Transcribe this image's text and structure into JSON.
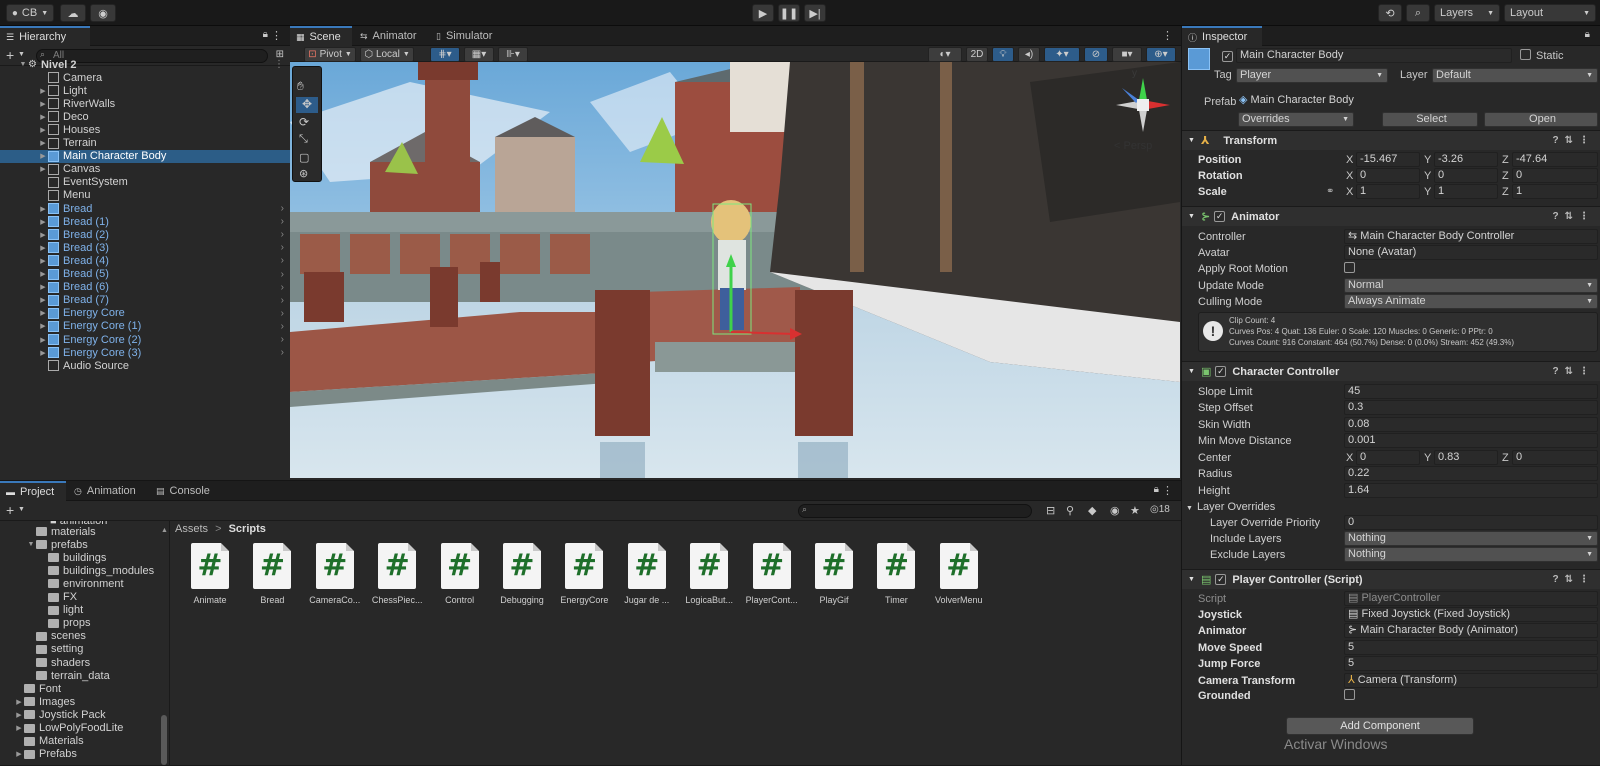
{
  "toolbar": {
    "account": "CB",
    "layers": "Layers",
    "layout": "Layout"
  },
  "hierarchy": {
    "tab": "Hierarchy",
    "search_placeholder": "All",
    "scene_name": "Nivel 2",
    "items": [
      {
        "label": "Camera",
        "blue": false,
        "expand": false
      },
      {
        "label": "Light",
        "blue": false,
        "expand": true
      },
      {
        "label": "RiverWalls",
        "blue": false,
        "expand": true
      },
      {
        "label": "Deco",
        "blue": false,
        "expand": true
      },
      {
        "label": "Houses",
        "blue": false,
        "expand": true
      },
      {
        "label": "Terrain",
        "blue": false,
        "expand": true
      },
      {
        "label": "Main Character Body",
        "blue": false,
        "expand": true,
        "selected": true
      },
      {
        "label": "Canvas",
        "blue": false,
        "expand": true
      },
      {
        "label": "EventSystem",
        "blue": false,
        "expand": false
      },
      {
        "label": "Menu",
        "blue": false,
        "expand": false
      },
      {
        "label": "Bread",
        "blue": true,
        "expand": true
      },
      {
        "label": "Bread (1)",
        "blue": true,
        "expand": true
      },
      {
        "label": "Bread (2)",
        "blue": true,
        "expand": true
      },
      {
        "label": "Bread (3)",
        "blue": true,
        "expand": true
      },
      {
        "label": "Bread (4)",
        "blue": true,
        "expand": true
      },
      {
        "label": "Bread (5)",
        "blue": true,
        "expand": true
      },
      {
        "label": "Bread (6)",
        "blue": true,
        "expand": true
      },
      {
        "label": "Bread (7)",
        "blue": true,
        "expand": true
      },
      {
        "label": "Energy Core",
        "blue": true,
        "expand": true
      },
      {
        "label": "Energy Core (1)",
        "blue": true,
        "expand": true
      },
      {
        "label": "Energy Core (2)",
        "blue": true,
        "expand": true
      },
      {
        "label": "Energy Core (3)",
        "blue": true,
        "expand": true
      },
      {
        "label": "Audio Source",
        "blue": false,
        "expand": false
      }
    ]
  },
  "scene": {
    "tabs": [
      "Scene",
      "Animator",
      "Simulator"
    ],
    "pivot": "Pivot",
    "local": "Local",
    "mode_2d": "2D",
    "persp": "< Persp",
    "gizmo_y": "y"
  },
  "project": {
    "tabs": [
      "Project",
      "Animation",
      "Console"
    ],
    "count": "18",
    "breadcrumb_root": "Assets",
    "breadcrumb_current": "Scripts",
    "tree": [
      {
        "label": "materials",
        "indent": 1
      },
      {
        "label": "prefabs",
        "indent": 1,
        "open": true
      },
      {
        "label": "buildings",
        "indent": 2
      },
      {
        "label": "buildings_modules",
        "indent": 2
      },
      {
        "label": "environment",
        "indent": 2
      },
      {
        "label": "FX",
        "indent": 2
      },
      {
        "label": "light",
        "indent": 2
      },
      {
        "label": "props",
        "indent": 2
      },
      {
        "label": "scenes",
        "indent": 1
      },
      {
        "label": "setting",
        "indent": 1
      },
      {
        "label": "shaders",
        "indent": 1
      },
      {
        "label": "terrain_data",
        "indent": 1
      },
      {
        "label": "Font",
        "indent": 0
      },
      {
        "label": "Images",
        "indent": 0,
        "expand": true
      },
      {
        "label": "Joystick Pack",
        "indent": 0,
        "expand": true
      },
      {
        "label": "LowPolyFoodLite",
        "indent": 0,
        "expand": true
      },
      {
        "label": "Materials",
        "indent": 0
      },
      {
        "label": "Prefabs",
        "indent": 0,
        "expand": true
      }
    ],
    "assets": [
      "Animate",
      "Bread",
      "CameraCo...",
      "ChessPiec...",
      "Control",
      "Debugging",
      "EnergyCore",
      "Jugar de ...",
      "LogicaBut...",
      "PlayerCont...",
      "PlayGif",
      "Timer",
      "VolverMenu"
    ]
  },
  "inspector": {
    "tab": "Inspector",
    "object_name": "Main Character Body",
    "static": "Static",
    "tag_label": "Tag",
    "tag_value": "Player",
    "layer_label": "Layer",
    "layer_value": "Default",
    "prefab_label": "Prefab",
    "prefab_value": "Main Character Body",
    "overrides": "Overrides",
    "select": "Select",
    "open": "Open",
    "transform": {
      "title": "Transform",
      "position_label": "Position",
      "px": "-15.467",
      "py": "-3.26",
      "pz": "-47.64",
      "rotation_label": "Rotation",
      "rx": "0",
      "ry": "0",
      "rz": "0",
      "scale_label": "Scale",
      "sx": "1",
      "sy": "1",
      "sz": "1"
    },
    "animator": {
      "title": "Animator",
      "controller_label": "Controller",
      "controller": "Main Character Body Controller",
      "avatar_label": "Avatar",
      "avatar": "None (Avatar)",
      "apply_root_label": "Apply Root Motion",
      "update_label": "Update Mode",
      "update": "Normal",
      "culling_label": "Culling Mode",
      "culling": "Always Animate",
      "info1": "Clip Count: 4",
      "info2": "Curves Pos: 4 Quat: 136 Euler: 0 Scale: 120 Muscles: 0 Generic: 0 PPtr: 0",
      "info3": "Curves Count: 916 Constant: 464 (50.7%) Dense: 0 (0.0%) Stream: 452 (49.3%)"
    },
    "character_controller": {
      "title": "Character Controller",
      "slope_label": "Slope Limit",
      "slope": "45",
      "step_label": "Step Offset",
      "step": "0.3",
      "skin_label": "Skin Width",
      "skin": "0.08",
      "minmove_label": "Min Move Distance",
      "minmove": "0.001",
      "center_label": "Center",
      "cx": "0",
      "cy": "0.83",
      "cz": "0",
      "radius_label": "Radius",
      "radius": "0.22",
      "height_label": "Height",
      "height": "1.64",
      "layer_overrides": "Layer Overrides",
      "priority_label": "Layer Override Priority",
      "priority": "0",
      "include_label": "Include Layers",
      "include": "Nothing",
      "exclude_label": "Exclude Layers",
      "exclude": "Nothing"
    },
    "player_controller": {
      "title": "Player Controller (Script)",
      "script_label": "Script",
      "script": "PlayerController",
      "joystick_label": "Joystick",
      "joystick": "Fixed Joystick (Fixed Joystick)",
      "animator_label": "Animator",
      "animator": "Main Character Body (Animator)",
      "move_label": "Move Speed",
      "move": "5",
      "jump_label": "Jump Force",
      "jump": "5",
      "camera_label": "Camera Transform",
      "camera": "Camera (Transform)",
      "grounded_label": "Grounded"
    },
    "add_component": "Add Component",
    "watermark": "Activar Windows"
  },
  "axis": {
    "x": "X",
    "y": "Y",
    "z": "Z"
  },
  "colors": {
    "selection": "#2c5d87",
    "prefab_blue": "#7fb2ea",
    "accent": "#3a79bb"
  }
}
